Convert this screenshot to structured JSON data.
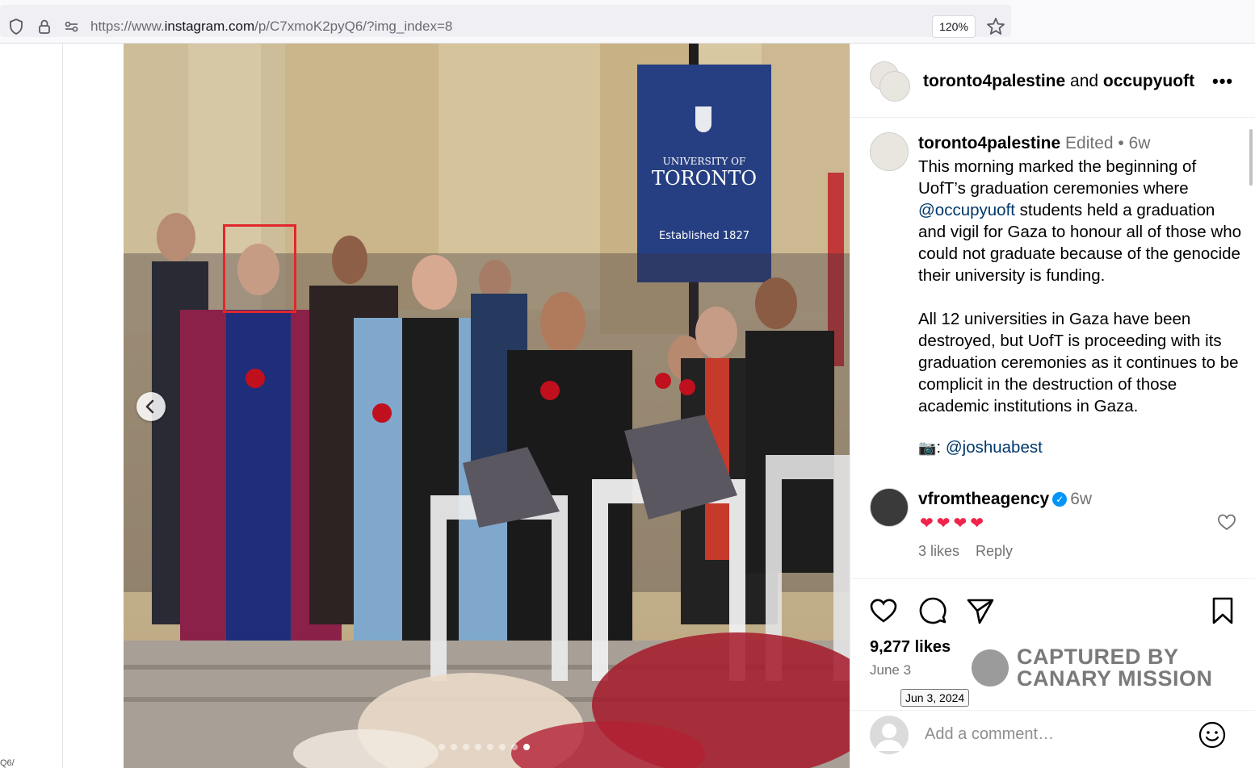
{
  "browser": {
    "url_prefix": "https://www.",
    "url_host": "instagram.com",
    "url_path": "/p/C7xmoK2pyQ6/?img_index=8",
    "zoom": "120%"
  },
  "gutter_text": "Q6/",
  "photo": {
    "carousel_total": 8,
    "carousel_active": 8,
    "banner": {
      "line1": "UNIVERSITY OF",
      "line2": "TORONTO",
      "line3": "Established 1827"
    }
  },
  "post": {
    "header": {
      "user1": "toronto4palestine",
      "connector": " and ",
      "user2": "occupyuoft",
      "more": "•••"
    },
    "caption": {
      "username": "toronto4palestine",
      "edited": "Edited",
      "sep": " • ",
      "age": "6w",
      "para1_a": "This morning marked the beginning of UofT’s graduation ceremonies where ",
      "mention1": "@occupyuoft",
      "para1_b": " students held a graduation and vigil for Gaza to honour all of those who could not graduate because of the genocide their university is funding.",
      "para2": "All 12 universities in Gaza have been destroyed, but UofT is proceeding with its graduation ceremonies as it continues to be complicit in the destruction of those academic institutions in Gaza.",
      "credit_icon": "📷",
      "credit_sep": ": ",
      "mention2": "@joshuabest"
    },
    "comment": {
      "username": "vfromtheagency",
      "verified": "✓",
      "age": "6w",
      "text": "❤❤❤❤",
      "likes": "3 likes",
      "reply": "Reply"
    },
    "likes": "9,277 likes",
    "date": "June 3",
    "date_tooltip": "Jun 3, 2024",
    "add_comment_placeholder": "Add a comment…"
  },
  "watermark": {
    "text": "CAPTURED BY\nCANARY MISSION"
  },
  "colors": {
    "link": "#00376b",
    "meta": "#737373",
    "heart": "#f0234b",
    "verified": "#0095f6",
    "highlight": "#e2272b"
  }
}
